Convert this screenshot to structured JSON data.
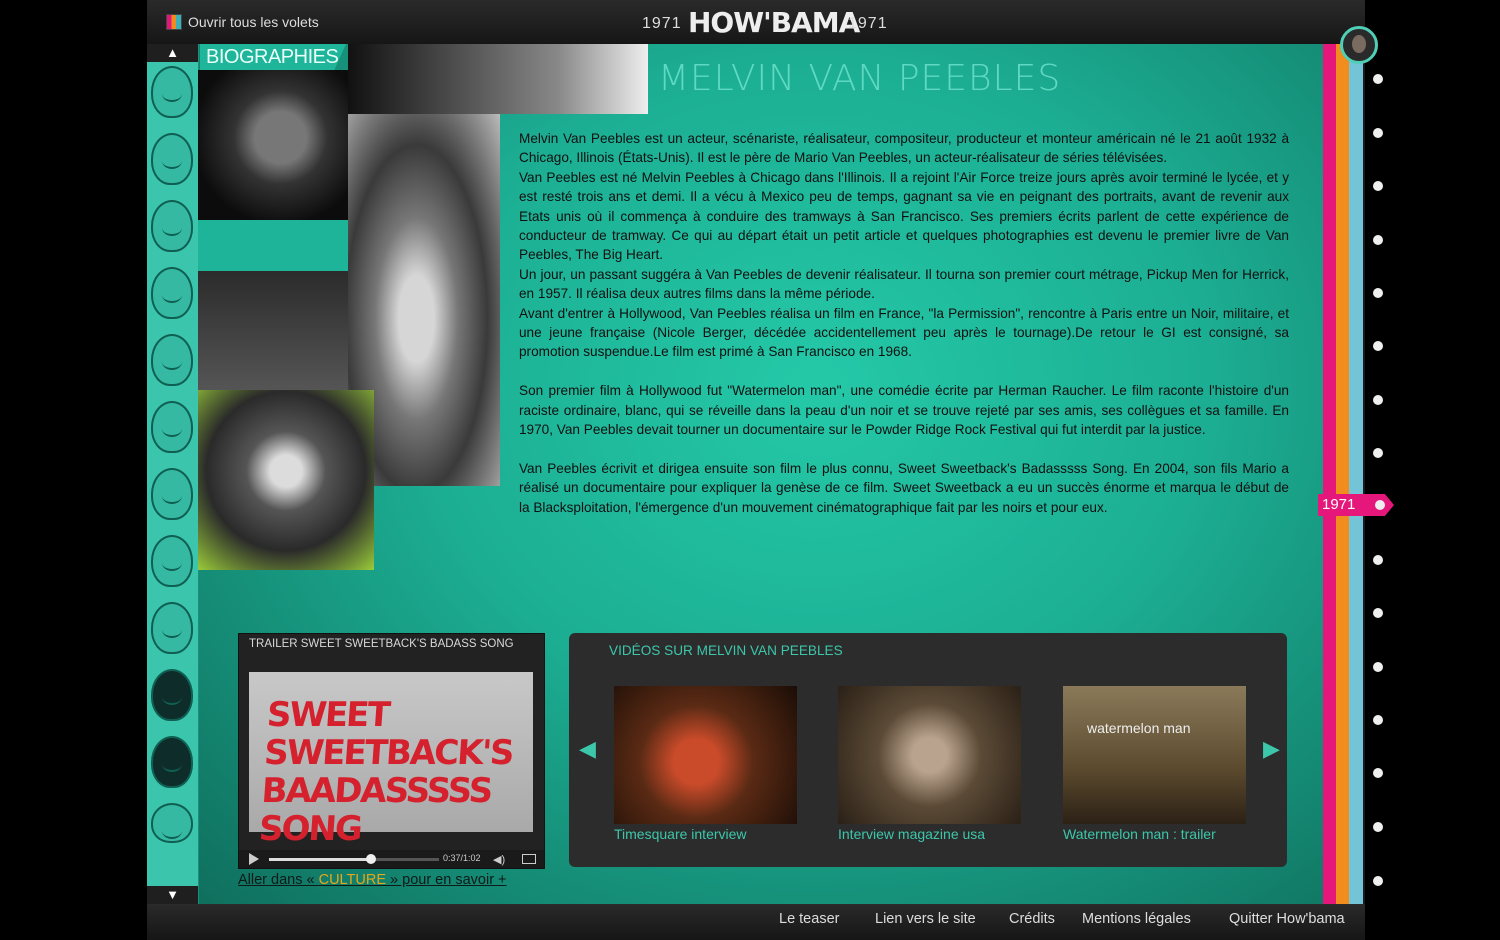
{
  "header": {
    "open_all_label": "Ouvrir tous les volets",
    "year_left": "1971",
    "logo": "HOW'BAMA",
    "year_right": "1971"
  },
  "sidebar": {
    "up_arrow": "▲",
    "down_arrow": "▼",
    "icon": "portrait-face-icon"
  },
  "section_tab": "BIOGRAPHIES",
  "page_title": "MELVIN VAN PEEBLES",
  "bio": {
    "p1": "Melvin Van Peebles est un acteur, scénariste, réalisateur, compositeur, producteur et monteur américain né le 21 août 1932 à Chicago, Illinois (États-Unis). Il est le père de Mario Van Peebles, un acteur-réalisateur de séries télévisées.",
    "p2": "Van Peebles est né Melvin Peebles à Chicago dans l'Illinois. Il a rejoint l'Air Force treize jours après avoir terminé le lycée, et y est resté trois ans et demi. Il a vécu à Mexico peu de temps, gagnant sa vie en peignant des portraits, avant de revenir aux Etats unis où il commença à conduire des tramways à San Francisco. Ses premiers écrits parlent de cette expérience de conducteur de tramway. Ce qui au départ était un petit article et quelques photographies est devenu le premier livre de Van Peebles, The Big Heart.",
    "p3": "Un jour, un passant suggéra à Van Peebles de devenir réalisateur. Il tourna son premier court métrage, Pickup Men for Herrick, en 1957. Il réalisa deux autres films dans la même période.",
    "p4": "Avant d'entrer à Hollywood, Van Peebles réalisa un film en France, \"la Permission\", rencontre à Paris entre un Noir, militaire, et une jeune française (Nicole Berger, décédée accidentellement peu après le tournage).De retour le GI est consigné, sa promotion suspendue.Le film est primé à San Francisco en 1968.",
    "p5": "Son premier film à Hollywood fut \"Watermelon man\", une comédie écrite par Herman Raucher. Le film raconte l'histoire d'un raciste ordinaire, blanc, qui se réveille dans la peau d'un noir et se trouve rejeté par ses amis, ses collègues et sa famille. En 1970, Van Peebles devait tourner un documentaire sur le Powder Ridge Rock Festival qui fut interdit par la justice.",
    "p6": "Van Peebles écrivit et dirigea ensuite son film le plus connu, Sweet Sweetback's Badasssss Song. En 2004, son fils Mario a réalisé un documentaire pour expliquer la genèse de ce film. Sweet Sweetback a eu un succès énorme et marqua le début de la Blacksploitation, l'émergence d'un mouvement cinématographique fait par les noirs et pour eux."
  },
  "trailer": {
    "title": "TRAILER SWEET SWEETBACK'S BADASS SONG",
    "screen_text_line1": "SWEET SWEETBACK'S",
    "screen_text_line2": "BAADASSSSS SONG",
    "time": "0:37/1:02",
    "progress": 0.6,
    "play_icon": "play-icon",
    "volume_icon": "volume-icon",
    "fullscreen_icon": "fullscreen-icon"
  },
  "more_link": {
    "before": "Aller dans « ",
    "highlight": "CULTURE",
    "after": " » pour en savoir +"
  },
  "videos": {
    "title": "VIDÉOS SUR MELVIN VAN PEEBLES",
    "prev": "◀",
    "next": "▶",
    "items": [
      {
        "caption": "Timesquare interview"
      },
      {
        "caption": "Interview magazine usa"
      },
      {
        "caption": "Watermelon man : trailer"
      }
    ],
    "thumb3_overlay": "watermelon man"
  },
  "timeline": {
    "current_year": "1971"
  },
  "footer": {
    "teaser": "Le teaser",
    "site_link": "Lien vers le site",
    "credits": "Crédits",
    "legal": "Mentions légales",
    "quit": "Quitter How'bama"
  },
  "colors": {
    "accent_teal": "#3bc5ad",
    "timeline_pink": "#e5177b",
    "timeline_orange": "#f28c1f",
    "timeline_blue": "#72c4d6",
    "highlight_gold": "#e4a81a"
  }
}
